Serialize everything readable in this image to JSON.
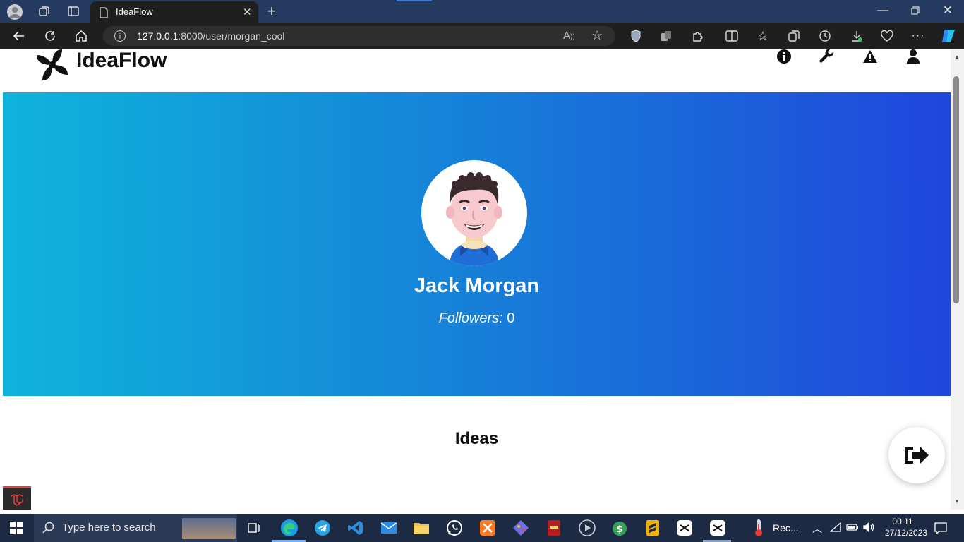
{
  "browser": {
    "tab_title": "IdeaFlow",
    "url_host": "127.0.0.1",
    "url_rest": ":8000/user/morgan_cool"
  },
  "app": {
    "brand": "IdeaFlow",
    "header_icons": [
      "info-icon",
      "wrench-icon",
      "warning-icon",
      "user-icon"
    ]
  },
  "profile": {
    "name": "Jack Morgan",
    "followers_label": "Followers:",
    "followers_count": "0"
  },
  "ideas": {
    "heading": "Ideas"
  },
  "taskbar": {
    "search_placeholder": "Type here to search",
    "recording_label": "Rec...",
    "time": "00:11",
    "date": "27/12/2023"
  },
  "colors": {
    "hero_gradient_start": "#0fb4db",
    "hero_gradient_end": "#2046dc",
    "browser_title_bar": "#243a5e",
    "taskbar": "#1c2a44"
  }
}
